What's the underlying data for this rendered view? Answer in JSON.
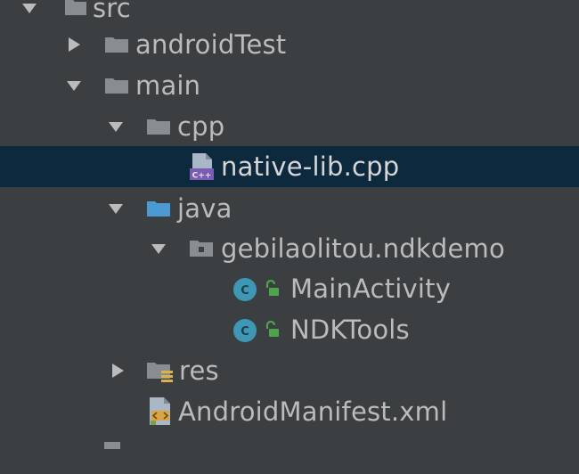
{
  "tree": {
    "colors": {
      "background": "#3c3f41",
      "selection": "#0d293e",
      "text": "#bbbbbb",
      "folder": "#8a8d8f",
      "source_folder": "#4b9ad1",
      "class_icon": "#3e97b5",
      "unlock": "#4fa34b"
    },
    "items": [
      {
        "label": "src",
        "icon": "folder-icon",
        "expanded": true
      },
      {
        "label": "androidTest",
        "icon": "folder-icon",
        "expanded": false
      },
      {
        "label": "main",
        "icon": "folder-icon",
        "expanded": true
      },
      {
        "label": "cpp",
        "icon": "folder-icon",
        "expanded": true
      },
      {
        "label": "native-lib.cpp",
        "icon": "cpp-file-icon",
        "selected": true,
        "badge": "C++"
      },
      {
        "label": "java",
        "icon": "source-folder-icon",
        "expanded": true
      },
      {
        "label": "gebilaolitou.ndkdemo",
        "icon": "package-icon",
        "expanded": true
      },
      {
        "label": "MainActivity",
        "icon": "class-icon",
        "badge": "C"
      },
      {
        "label": "NDKTools",
        "icon": "class-icon",
        "badge": "C"
      },
      {
        "label": "res",
        "icon": "resource-folder-icon",
        "expanded": false
      },
      {
        "label": "AndroidManifest.xml",
        "icon": "manifest-file-icon"
      }
    ]
  }
}
